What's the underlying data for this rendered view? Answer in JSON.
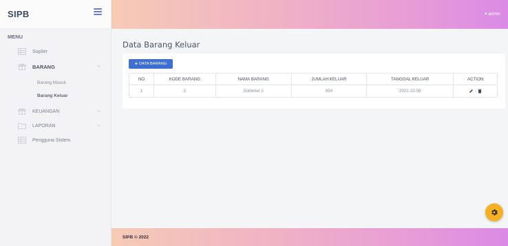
{
  "brand": {
    "title": "SIPB"
  },
  "topbar": {
    "user_label": "▾ admin"
  },
  "sidebar": {
    "menu_header": "MENU",
    "items": [
      {
        "label": "Suplier",
        "icon": "table-icon"
      },
      {
        "label": "BARANG",
        "icon": "gift-icon"
      },
      {
        "label": "KEUANGAN",
        "icon": "gift-icon"
      },
      {
        "label": "LAPORAN",
        "icon": "folder-icon"
      },
      {
        "label": "Pengguna Sistem",
        "icon": "table-icon"
      }
    ],
    "barang_sub": [
      {
        "label": "Barang Masuk"
      },
      {
        "label": "Barang Keluar"
      }
    ]
  },
  "page": {
    "title": "Data Barang Keluar"
  },
  "toolbar": {
    "add_label": "DATA BARANG"
  },
  "table": {
    "headers": [
      "NO",
      "KODE BARANG",
      "NAMA BARANG",
      "JUMLAH KELUAR",
      "TANGGAL KELUAR",
      "ACTION"
    ],
    "rows": [
      {
        "no": "1",
        "kode": "2",
        "nama": "Sobleker s",
        "jumlah": "454",
        "tanggal": "2021-10-08"
      }
    ]
  },
  "footer": {
    "text": "SIPB © 2022"
  },
  "colors": {
    "accent": "#3f6fd1",
    "fab": "#f5b025",
    "gradient_start": "#f6cbb5",
    "gradient_end": "#d98be6"
  }
}
